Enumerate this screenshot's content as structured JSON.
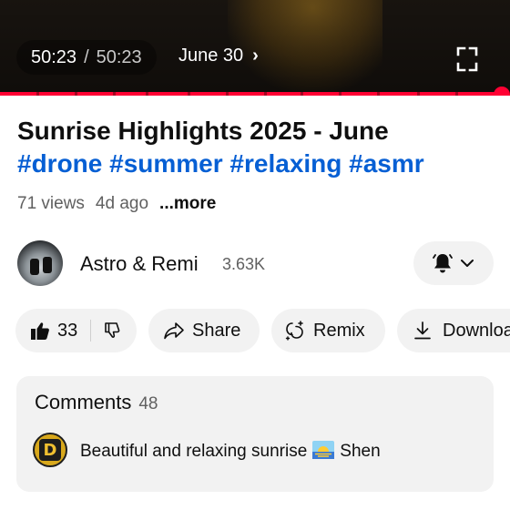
{
  "player": {
    "current_time": "50:23",
    "separator": "/",
    "duration": "50:23",
    "chapter_label": "June 30",
    "chapter_chevron": "›",
    "progress": 1.0
  },
  "video": {
    "title": "Sunrise Highlights 2025 - June",
    "hashtags": "#drone #summer #relaxing #asmr",
    "views": "71 views",
    "age": "4d ago",
    "more_label": "...more"
  },
  "channel": {
    "name": "Astro & Remi",
    "subscribers": "3.63K"
  },
  "actions": {
    "likes": "33",
    "share_label": "Share",
    "remix_label": "Remix",
    "download_label": "Download"
  },
  "comments": {
    "label": "Comments",
    "count": "48",
    "top_comment_text": "Beautiful and relaxing sunrise",
    "top_comment_suffix": "Shen",
    "commenter_avatar_letter": "D"
  },
  "colors": {
    "accent_red": "#ff0033",
    "link_blue": "#065fd4",
    "chip_bg": "#f2f2f2"
  },
  "icons": [
    "fullscreen-icon",
    "chevron-right-icon",
    "bell-icon",
    "chevron-down-icon",
    "like-icon",
    "dislike-icon",
    "share-icon",
    "remix-icon",
    "download-icon",
    "sunrise-emoji"
  ]
}
